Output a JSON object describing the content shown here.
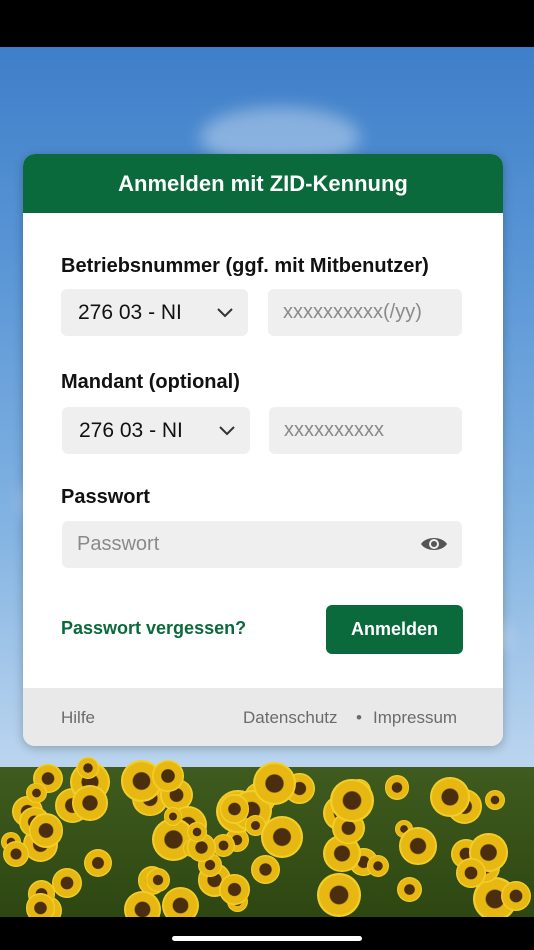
{
  "header": {
    "title": "Anmelden mit ZID-Kennung"
  },
  "betrieb": {
    "label": "Betriebsnummer (ggf. mit Mitbenutzer)",
    "select_value": "276 03 - NI",
    "input_placeholder": "xxxxxxxxxx(/yy)"
  },
  "mandant": {
    "label": "Mandant (optional)",
    "select_value": "276 03 - NI",
    "input_placeholder": "xxxxxxxxxx"
  },
  "password": {
    "label": "Passwort",
    "placeholder": "Passwort"
  },
  "actions": {
    "forgot": "Passwort vergessen?",
    "login": "Anmelden"
  },
  "footer": {
    "help": "Hilfe",
    "privacy": "Datenschutz",
    "separator": "•",
    "imprint": "Impressum"
  },
  "colors": {
    "brand": "#0b6a3c"
  }
}
